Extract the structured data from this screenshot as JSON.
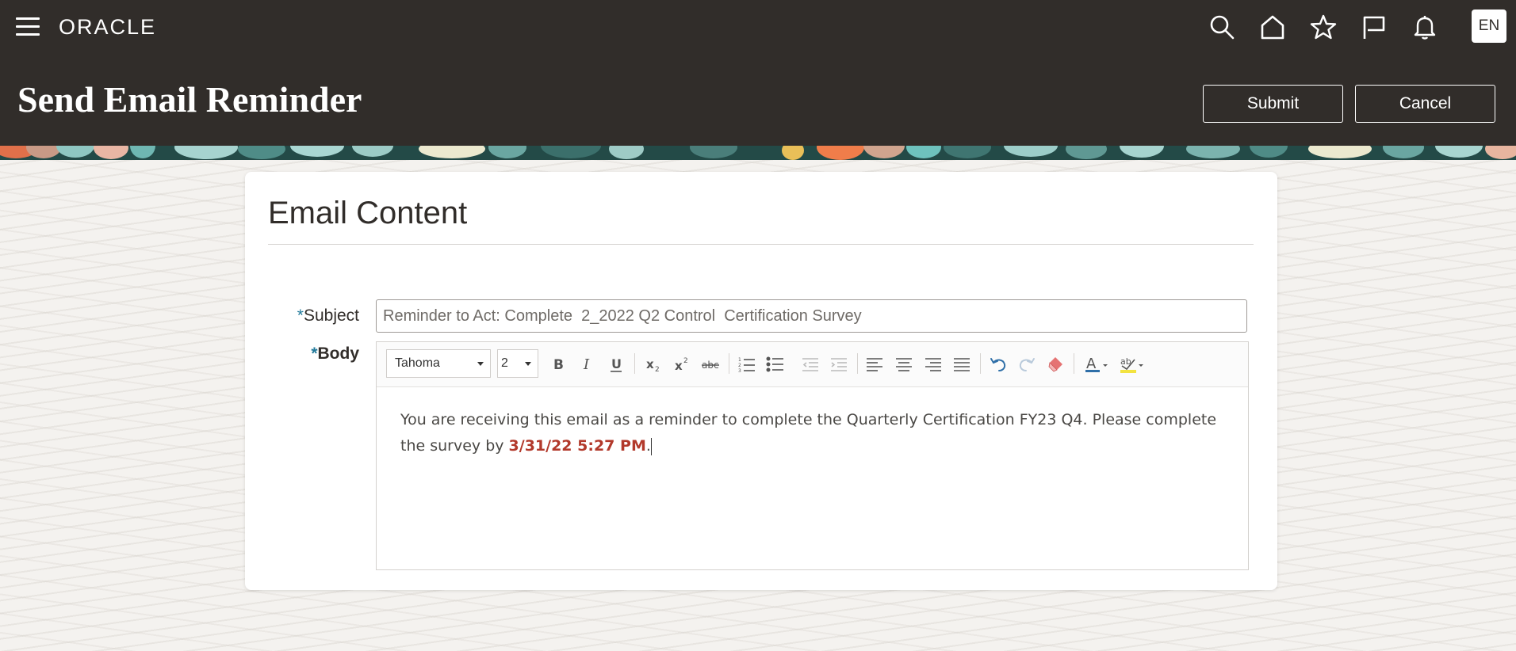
{
  "header": {
    "brand": "ORACLE",
    "language": "EN",
    "page_title": "Send Email Reminder",
    "submit_label": "Submit",
    "cancel_label": "Cancel",
    "icons": [
      "menu-icon",
      "search-icon",
      "home-icon",
      "star-icon",
      "flag-icon",
      "bell-icon"
    ]
  },
  "card": {
    "title": "Email Content"
  },
  "form": {
    "subject_required_mark": "*",
    "subject_label": "Subject",
    "subject_value": "Reminder to Act: Complete  2_2022 Q2 Control  Certification Survey",
    "body_required_mark": "*",
    "body_label": "Body"
  },
  "editor": {
    "font": "Tahoma",
    "size": "2",
    "toolbar_icons": [
      "bold-icon",
      "italic-icon",
      "underline-icon",
      "subscript-icon",
      "superscript-icon",
      "strikethrough-icon",
      "ordered-list-icon",
      "unordered-list-icon",
      "outdent-icon",
      "indent-icon",
      "align-left-icon",
      "align-center-icon",
      "align-right-icon",
      "justify-icon",
      "undo-icon",
      "redo-icon",
      "clear-format-icon",
      "text-color-icon",
      "highlight-color-icon"
    ],
    "body_text_prefix": "You are receiving this email as a reminder to complete the Quarterly Certification FY23 Q4. Please complete the survey by ",
    "body_due_date": "3/31/22 5:27 PM",
    "body_text_suffix": "."
  },
  "colors": {
    "header_bg": "#312d2a",
    "required_mark": "#227a9b",
    "due_date": "#b2392b"
  }
}
